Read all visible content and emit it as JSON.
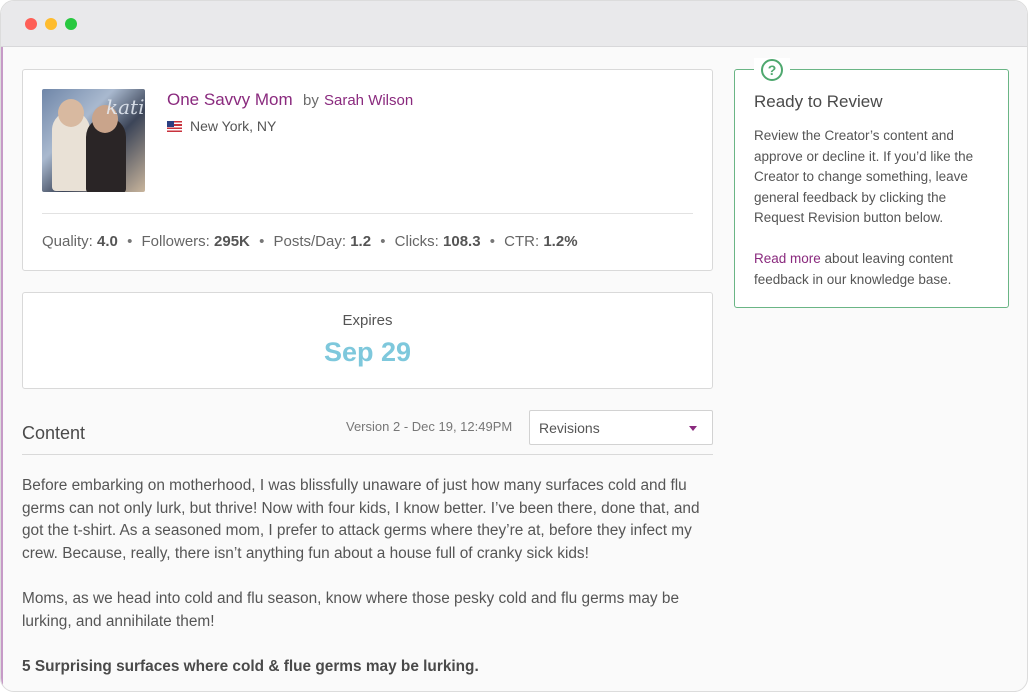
{
  "creator": {
    "blog_name": "One Savvy Mom",
    "by": "by",
    "author": "Sarah Wilson",
    "location": "New York, NY",
    "stats": {
      "quality_label": "Quality:",
      "quality": "4.0",
      "followers_label": "Followers:",
      "followers": "295K",
      "posts_label": "Posts/Day:",
      "posts": "1.2",
      "clicks_label": "Clicks:",
      "clicks": "108.3",
      "ctr_label": "CTR:",
      "ctr": "1.2%",
      "separator": "•"
    }
  },
  "expires": {
    "label": "Expires",
    "date": "Sep 29"
  },
  "content": {
    "title": "Content",
    "version": "Version 2 - Dec 19, 12:49PM",
    "revisions_label": "Revisions",
    "paragraphs": [
      "Before embarking on motherhood, I was blissfully unaware of just how many surfaces cold and flu germs can not only lurk, but thrive! Now with four kids, I know better. I’ve been there, done that, and got the t-shirt. As a seasoned mom, I prefer to attack germs where they’re at, before they infect my crew. Because, really, there isn’t anything fun about a house full of cranky sick kids!",
      "Moms, as we head into cold and flu season, know where those pesky cold and flu germs may be lurking, and annihilate them!",
      "5 Surprising surfaces where cold & flue germs may be lurking."
    ]
  },
  "review": {
    "title": "Ready to Review",
    "body": "Review the Creator’s content and approve or decline it. If you’d like the Creator to change something, leave general feedback by clicking the Request Revision button below.",
    "link": "Read more",
    "link_suffix": " about leaving content feedback in our knowledge base.",
    "help_glyph": "?"
  },
  "colors": {
    "accent": "#8a2a7e",
    "expires": "#7ec8dc",
    "review_border": "#6ab585"
  }
}
